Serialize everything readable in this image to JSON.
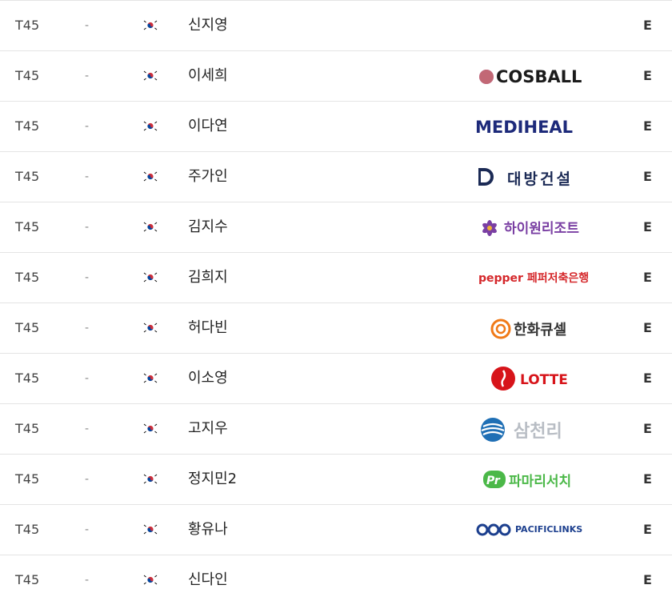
{
  "rows": [
    {
      "pos": "T45",
      "diff": "-",
      "name": "신지영",
      "sponsor": "",
      "round": "E"
    },
    {
      "pos": "T45",
      "diff": "-",
      "name": "이세희",
      "sponsor": "COSBALL",
      "round": "E"
    },
    {
      "pos": "T45",
      "diff": "-",
      "name": "이다연",
      "sponsor": "MEDIHEAL",
      "round": "E"
    },
    {
      "pos": "T45",
      "diff": "-",
      "name": "주가인",
      "sponsor": "대방건설",
      "round": "E"
    },
    {
      "pos": "T45",
      "diff": "-",
      "name": "김지수",
      "sponsor": "하이원리조트",
      "round": "E"
    },
    {
      "pos": "T45",
      "diff": "-",
      "name": "김희지",
      "sponsor": "pepper 페퍼저축은행",
      "round": "E"
    },
    {
      "pos": "T45",
      "diff": "-",
      "name": "허다빈",
      "sponsor": "한화큐셀",
      "round": "E"
    },
    {
      "pos": "T45",
      "diff": "-",
      "name": "이소영",
      "sponsor": "LOTTE",
      "round": "E"
    },
    {
      "pos": "T45",
      "diff": "-",
      "name": "고지우",
      "sponsor": "삼천리",
      "round": "E"
    },
    {
      "pos": "T45",
      "diff": "-",
      "name": "정지민2",
      "sponsor": "파마리서치",
      "round": "E"
    },
    {
      "pos": "T45",
      "diff": "-",
      "name": "황유나",
      "sponsor": "PACIFICLINKS",
      "round": "E"
    },
    {
      "pos": "T45",
      "diff": "-",
      "name": "신다인",
      "sponsor": "",
      "round": "E"
    }
  ],
  "colors": {
    "cosball": "#1b1b1b",
    "mediheal": "#1d2a7a",
    "daebang": "#1b2a55",
    "high1": "#7a3fa3",
    "pepper": "#d5282b",
    "hanwha": "#f07a18",
    "lotte": "#d7141a",
    "samchully": "#1f6fb5",
    "pharma": "#4bb848",
    "pacific": "#1c3f8e"
  }
}
